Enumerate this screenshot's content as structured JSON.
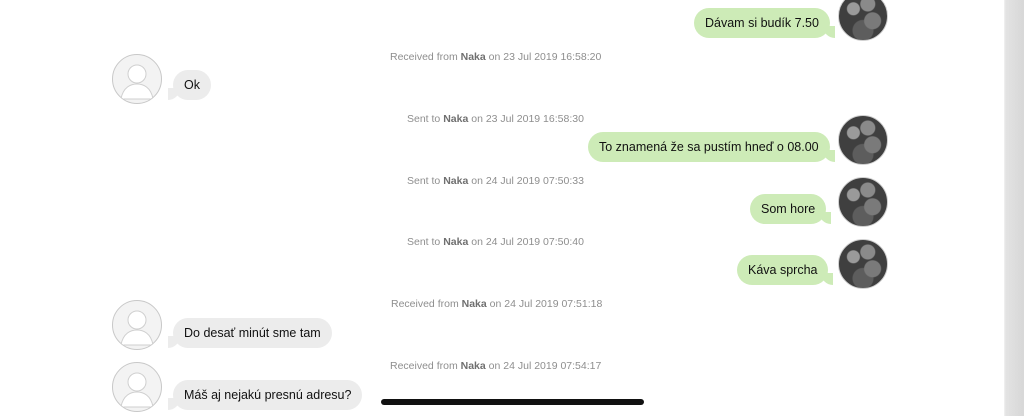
{
  "contact_name": "Naka",
  "messages": [
    {
      "direction": "sent",
      "text": "Dávam si budík 7.50"
    },
    {
      "direction": "received",
      "prefix": "Received from",
      "name": "Naka",
      "suffix": "on 23 Jul 2019 16:58:20",
      "text": "Ok"
    },
    {
      "direction": "sent",
      "prefix": "Sent to",
      "name": "Naka",
      "suffix": "on 23 Jul 2019 16:58:30",
      "text": "To znamená že sa pustím hneď o 08.00"
    },
    {
      "direction": "sent",
      "prefix": "Sent to",
      "name": "Naka",
      "suffix": "on 24 Jul 2019 07:50:33",
      "text": "Som hore"
    },
    {
      "direction": "sent",
      "prefix": "Sent to",
      "name": "Naka",
      "suffix": "on 24 Jul 2019 07:50:40",
      "text": "Káva sprcha"
    },
    {
      "direction": "received",
      "prefix": "Received from",
      "name": "Naka",
      "suffix": "on 24 Jul 2019 07:51:18",
      "text": "Do desať minút sme tam"
    },
    {
      "direction": "received",
      "prefix": "Received from",
      "name": "Naka",
      "suffix": "on 24 Jul 2019 07:54:17",
      "text": "Máš aj nejakú presnú adresu?"
    }
  ],
  "avatars": {
    "me": "user-photo-avatar",
    "other": "default-person-avatar"
  },
  "colors": {
    "sent_bubble": "#cdebb7",
    "received_bubble": "#ececec",
    "timestamp": "#8e8e8e"
  }
}
